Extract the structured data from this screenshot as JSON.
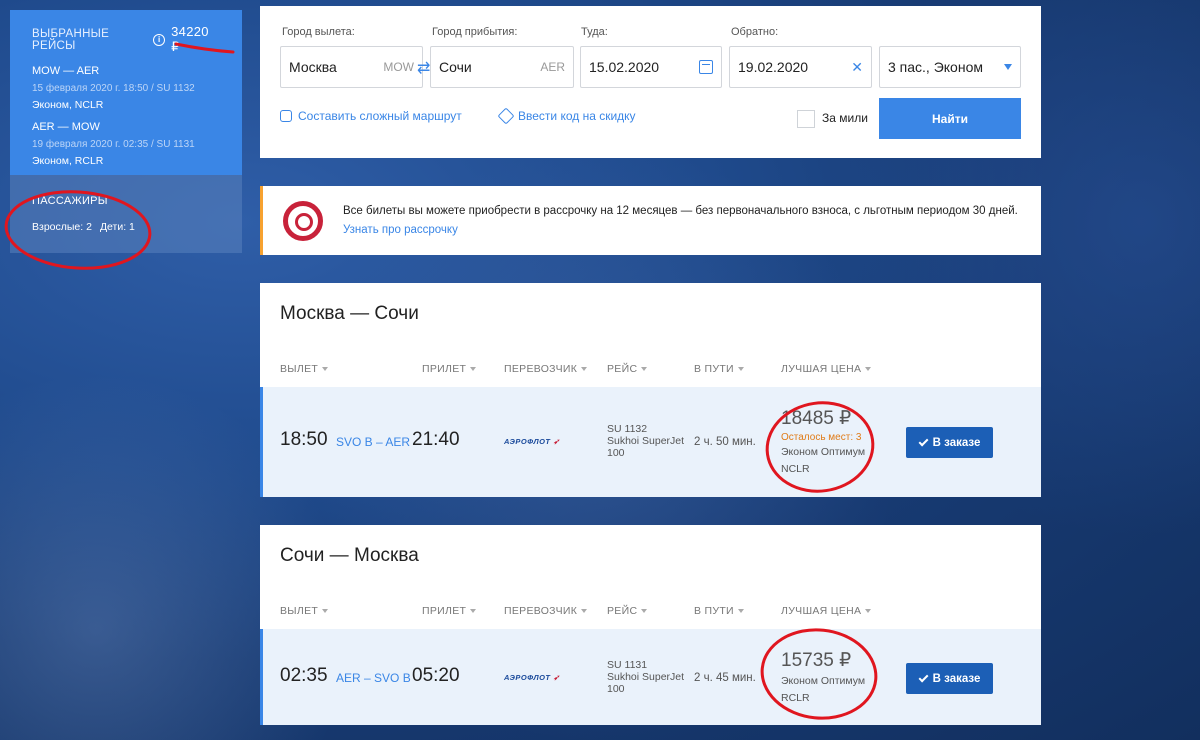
{
  "sidebar": {
    "selected_title": "ВЫБРАННЫЕ РЕЙСЫ",
    "total_price": "34220 ₽",
    "legs": [
      {
        "route": "MOW — AER",
        "date": "15 февраля 2020 г. 18:50 / SU 1132",
        "fare": "Эконом, NCLR"
      },
      {
        "route": "AER — MOW",
        "date": "19 февраля 2020 г. 02:35 / SU 1131",
        "fare": "Эконом, RCLR"
      }
    ],
    "passengers_title": "ПАССАЖИРЫ",
    "adults": "Взрослые: 2",
    "children": "Дети: 1"
  },
  "search": {
    "from_label": "Город вылета:",
    "from_value": "Москва",
    "from_code": "MOW",
    "to_label": "Город прибытия:",
    "to_value": "Сочи",
    "to_code": "AER",
    "depart_label": "Туда:",
    "depart_value": "15.02.2020",
    "return_label": "Обратно:",
    "return_value": "19.02.2020",
    "passengers_value": "3 пас., Эконом",
    "complex_route_link": "Составить сложный маршрут",
    "promo_code_link": "Ввести код на скидку",
    "miles_label": "За мили",
    "find_button": "Найти"
  },
  "promo": {
    "text": "Все билеты вы можете приобрести в рассрочку на 12 месяцев — без первоначального взноса, с льготным периодом 30 дней.",
    "link": "Узнать про рассрочку"
  },
  "columns": {
    "depart": "ВЫЛЕТ",
    "arrive": "ПРИЛЕТ",
    "carrier": "ПЕРЕВОЗЧИК",
    "flight": "РЕЙС",
    "duration": "В ПУТИ",
    "best_price": "ЛУЧШАЯ ЦЕНА"
  },
  "outbound": {
    "title": "Москва — Сочи",
    "depart_time": "18:50",
    "airports": "SVO B – AER",
    "arrive_time": "21:40",
    "airline": "АЭРОФЛОТ",
    "flight_no": "SU 1132",
    "aircraft": "Sukhoi SuperJet 100",
    "duration": "2 ч. 50 мин.",
    "price": "18485 ₽",
    "seats_left": "Осталось мест: 3",
    "fare_name": "Эконом Оптимум",
    "fare_code": "NCLR",
    "button": "В заказе"
  },
  "inbound": {
    "title": "Сочи — Москва",
    "depart_time": "02:35",
    "airports": "AER – SVO B",
    "arrive_time": "05:20",
    "airline": "АЭРОФЛОТ",
    "flight_no": "SU 1131",
    "aircraft": "Sukhoi SuperJet 100",
    "duration": "2 ч. 45 мин.",
    "price": "15735 ₽",
    "fare_name": "Эконом Оптимум",
    "fare_code": "RCLR",
    "button": "В заказе"
  },
  "colors": {
    "accent": "#3a86e6",
    "button_dark": "#1c5fb6",
    "warning": "#e07b17",
    "annotation": "#e0161f"
  }
}
